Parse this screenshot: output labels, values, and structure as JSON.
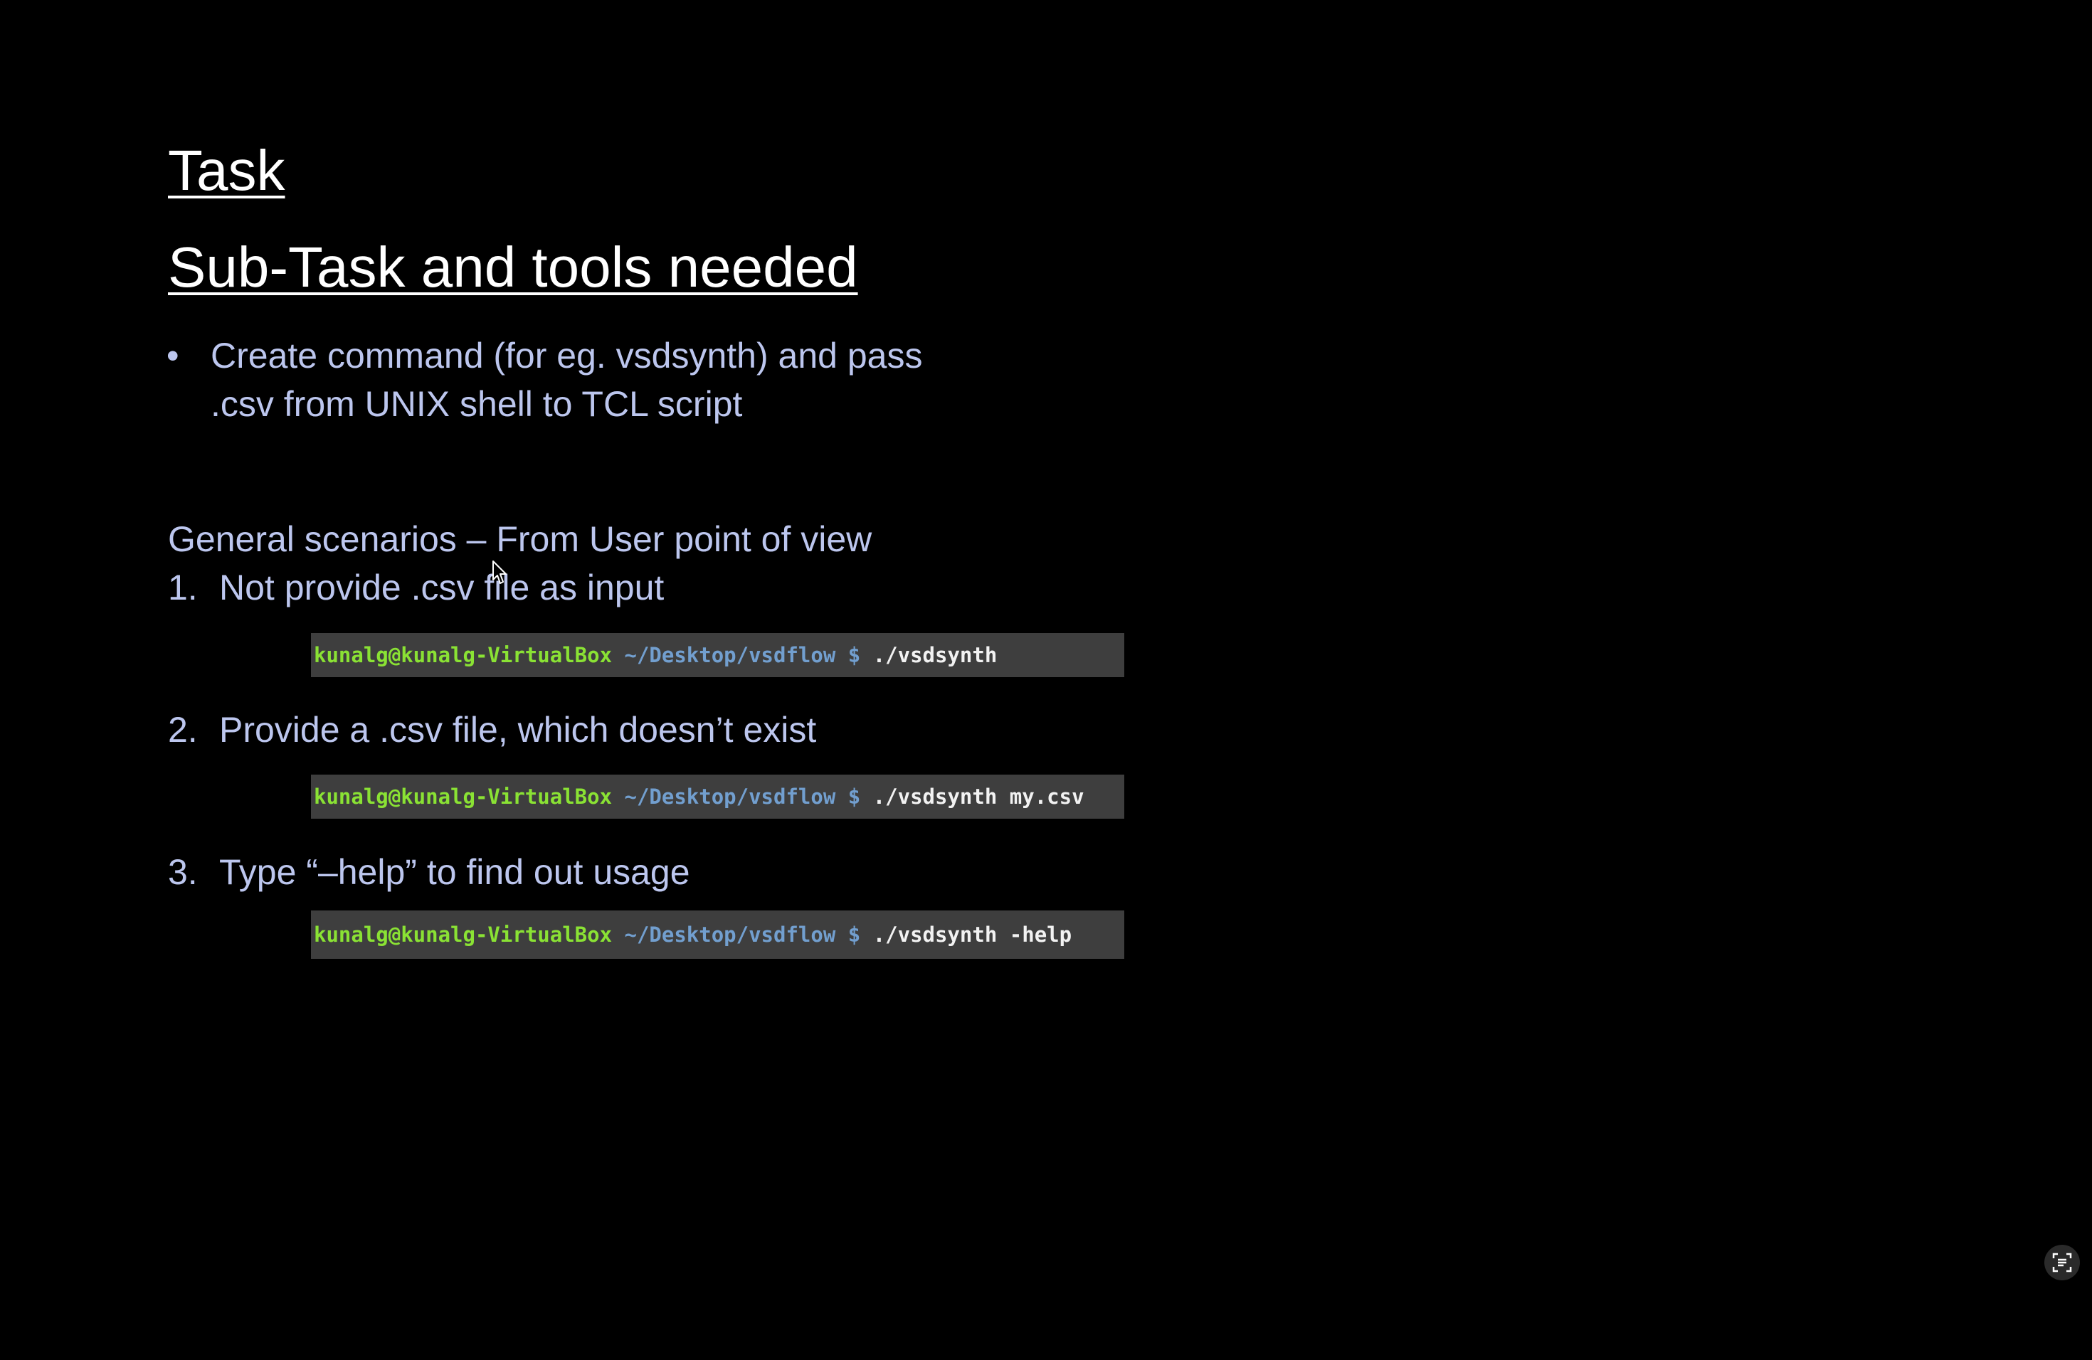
{
  "slide": {
    "title": "Task",
    "subtitle": "Sub-Task and tools needed",
    "bullet": {
      "mark": "•",
      "line1": "Create command (for eg. vsdsynth) and pass",
      "line2": ".csv from UNIX shell to TCL script"
    },
    "scenarios_heading": "General scenarios – From User point of view",
    "scenarios": [
      {
        "number": "1.",
        "text": "Not provide .csv file as input",
        "terminal": {
          "user": "kunalg@kunalg-VirtualBox",
          "path": "~/Desktop/vsdflow",
          "prompt": "$",
          "command": "./vsdsynth"
        }
      },
      {
        "number": "2.",
        "text": "Provide a .csv file, which doesn’t exist",
        "terminal": {
          "user": "kunalg@kunalg-VirtualBox",
          "path": "~/Desktop/vsdflow",
          "prompt": "$",
          "command": "./vsdsynth my.csv"
        }
      },
      {
        "number": "3.",
        "text": "Type “–help” to find out usage",
        "terminal": {
          "user": "kunalg@kunalg-VirtualBox",
          "path": "~/Desktop/vsdflow",
          "prompt": "$",
          "command": "./vsdsynth -help"
        }
      }
    ]
  },
  "icons": {
    "cursor": "mouse-pointer-icon",
    "corner": "text-scan-icon"
  },
  "colors": {
    "background": "#000000",
    "title": "#ffffff",
    "body_text": "#bcc6ee",
    "terminal_bg": "#3e3e3e",
    "terminal_user": "#8ae234",
    "terminal_path": "#729fcf",
    "terminal_cmd": "#f2f2f2"
  }
}
